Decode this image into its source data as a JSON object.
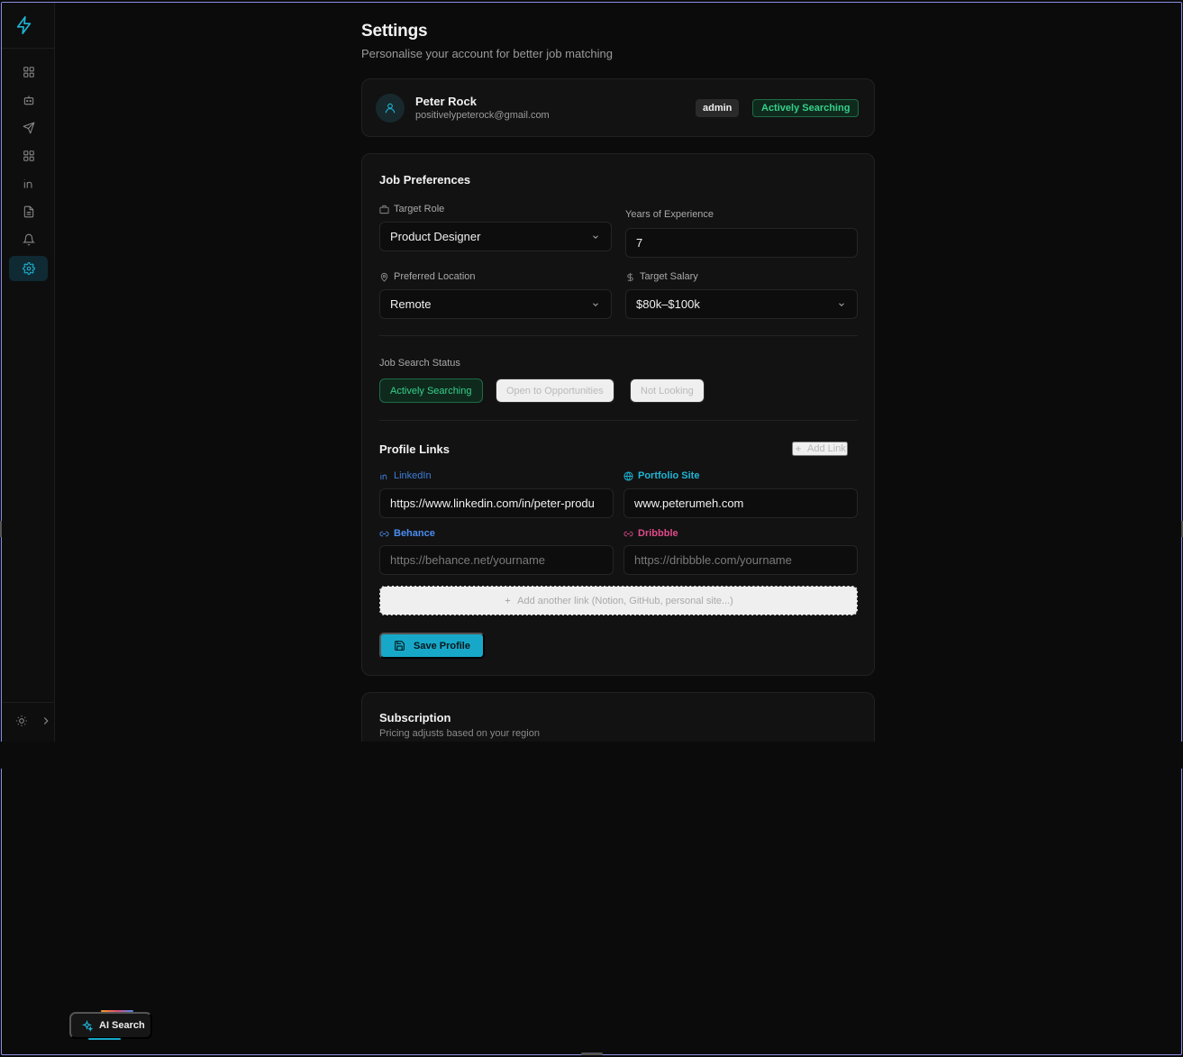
{
  "page": {
    "title": "Settings",
    "subtitle": "Personalise your account for better job matching"
  },
  "sidebar": {
    "items": [
      {
        "icon": "dashboard-icon"
      },
      {
        "icon": "bot-icon"
      },
      {
        "icon": "send-icon"
      },
      {
        "icon": "grid-icon"
      },
      {
        "icon": "linkedin-icon"
      },
      {
        "icon": "document-icon"
      },
      {
        "icon": "bell-icon"
      },
      {
        "icon": "gear-icon",
        "active": true
      }
    ]
  },
  "profile": {
    "name": "Peter Rock",
    "email": "positivelypeterock@gmail.com",
    "role_badge": "admin",
    "status_badge": "Actively Searching"
  },
  "preferences": {
    "title": "Job Preferences",
    "target_role": {
      "label": "Target Role",
      "value": "Product Designer"
    },
    "years_experience": {
      "label": "Years of Experience",
      "value": "7"
    },
    "preferred_location": {
      "label": "Preferred Location",
      "value": "Remote"
    },
    "target_salary": {
      "label": "Target Salary",
      "value": "$80k–$100k"
    },
    "search_status": {
      "label": "Job Search Status",
      "options": [
        "Actively Searching",
        "Open to Opportunities",
        "Not Looking"
      ],
      "selected": "Actively Searching"
    }
  },
  "profile_links": {
    "title": "Profile Links",
    "add_link_label": "Add Link",
    "linkedin": {
      "label": "LinkedIn",
      "value": "https://www.linkedin.com/in/peter-produ",
      "color": "#3d7fd9"
    },
    "portfolio": {
      "label": "Portfolio Site",
      "value": "www.peterumeh.com",
      "color": "#1fb5d6"
    },
    "behance": {
      "label": "Behance",
      "placeholder": "https://behance.net/yourname",
      "color": "#4a8df0"
    },
    "dribbble": {
      "label": "Dribbble",
      "placeholder": "https://dribbble.com/yourname",
      "color": "#e04a8a"
    },
    "add_another_label": "Add another link (Notion, GitHub, personal site...)",
    "save_label": "Save Profile"
  },
  "subscription": {
    "title": "Subscription",
    "subtitle": "Pricing adjusts based on your region"
  },
  "ai_search": {
    "label": "AI Search"
  },
  "colors": {
    "accent": "#17a8c9",
    "success": "#35d08a",
    "background": "#0b0b0b"
  }
}
